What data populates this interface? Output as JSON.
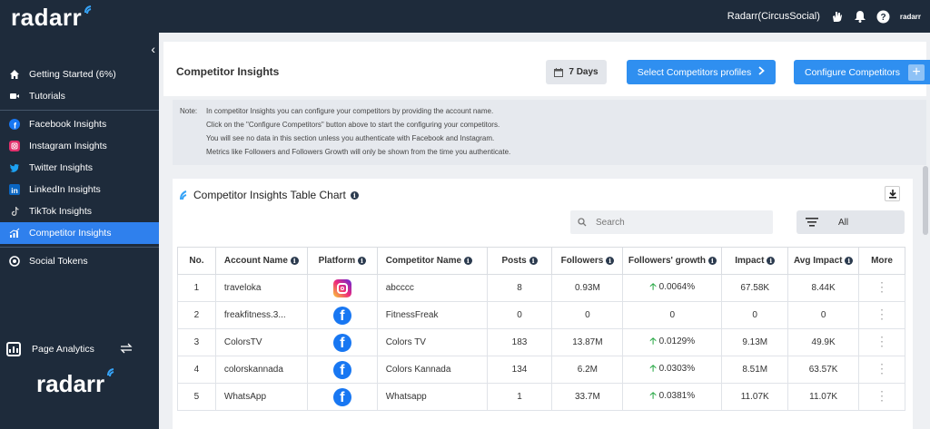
{
  "topbar": {
    "logo": "radarr",
    "account": "Radarr(CircusSocial)",
    "mini_logo": "radarr"
  },
  "sidebar": {
    "items": [
      {
        "label": "Getting Started (6%)",
        "icon": "home-icon"
      },
      {
        "label": "Tutorials",
        "icon": "video-icon"
      },
      {
        "label": "Facebook Insights",
        "icon": "facebook-icon"
      },
      {
        "label": "Instagram Insights",
        "icon": "instagram-icon"
      },
      {
        "label": "Twitter Insights",
        "icon": "twitter-icon"
      },
      {
        "label": "LinkedIn Insights",
        "icon": "linkedin-icon"
      },
      {
        "label": "TikTok Insights",
        "icon": "tiktok-icon"
      },
      {
        "label": "Competitor Insights",
        "icon": "analytics-icon",
        "active": true
      },
      {
        "label": "Social Tokens",
        "icon": "token-icon"
      }
    ],
    "page_analytics": "Page Analytics",
    "bottom_logo": "radarr"
  },
  "header": {
    "title": "Competitor Insights",
    "days_label": "7 Days",
    "select_label": "Select Competitors profiles",
    "configure_label": "Configure Competitors"
  },
  "note": {
    "label": "Note:",
    "lines": [
      "In competitor Insights you can configure your competitors by providing the account name.",
      "Click on the \"Configure Competitors\" button above to start the configuring your competitors.",
      "You will see no data in this section unless you authenticate with Facebook and Instagram.",
      "Metrics like Followers and Followers Growth will only be shown from the time you authenticate."
    ]
  },
  "card": {
    "title": "Competitor Insights Table Chart",
    "search_placeholder": "Search",
    "filter_label": "All"
  },
  "table": {
    "headers": [
      "No.",
      "Account Name",
      "Platform",
      "Competitor Name",
      "Posts",
      "Followers",
      "Followers' growth",
      "Impact",
      "Avg Impact",
      "More"
    ],
    "rows": [
      {
        "no": "1",
        "account": "traveloka",
        "platform": "instagram",
        "competitor": "abcccc",
        "posts": "8",
        "followers": "0.93M",
        "growth": "0.0064%",
        "growth_up": true,
        "impact": "67.58K",
        "avg": "8.44K"
      },
      {
        "no": "2",
        "account": "freakfitness.3...",
        "platform": "facebook",
        "competitor": "FitnessFreak",
        "posts": "0",
        "followers": "0",
        "growth": "0",
        "growth_up": false,
        "impact": "0",
        "avg": "0"
      },
      {
        "no": "3",
        "account": "ColorsTV",
        "platform": "facebook",
        "competitor": "Colors TV",
        "posts": "183",
        "followers": "13.87M",
        "growth": "0.0129%",
        "growth_up": true,
        "impact": "9.13M",
        "avg": "49.9K"
      },
      {
        "no": "4",
        "account": "colorskannada",
        "platform": "facebook",
        "competitor": "Colors Kannada",
        "posts": "134",
        "followers": "6.2M",
        "growth": "0.0303%",
        "growth_up": true,
        "impact": "8.51M",
        "avg": "63.57K"
      },
      {
        "no": "5",
        "account": "WhatsApp",
        "platform": "facebook",
        "competitor": "Whatsapp",
        "posts": "1",
        "followers": "33.7M",
        "growth": "0.0381%",
        "growth_up": true,
        "impact": "11.07K",
        "avg": "11.07K"
      }
    ]
  },
  "colors": {
    "sidebar_bg": "#1e2b3b",
    "accent": "#2f80ed",
    "positive": "#27a844"
  }
}
